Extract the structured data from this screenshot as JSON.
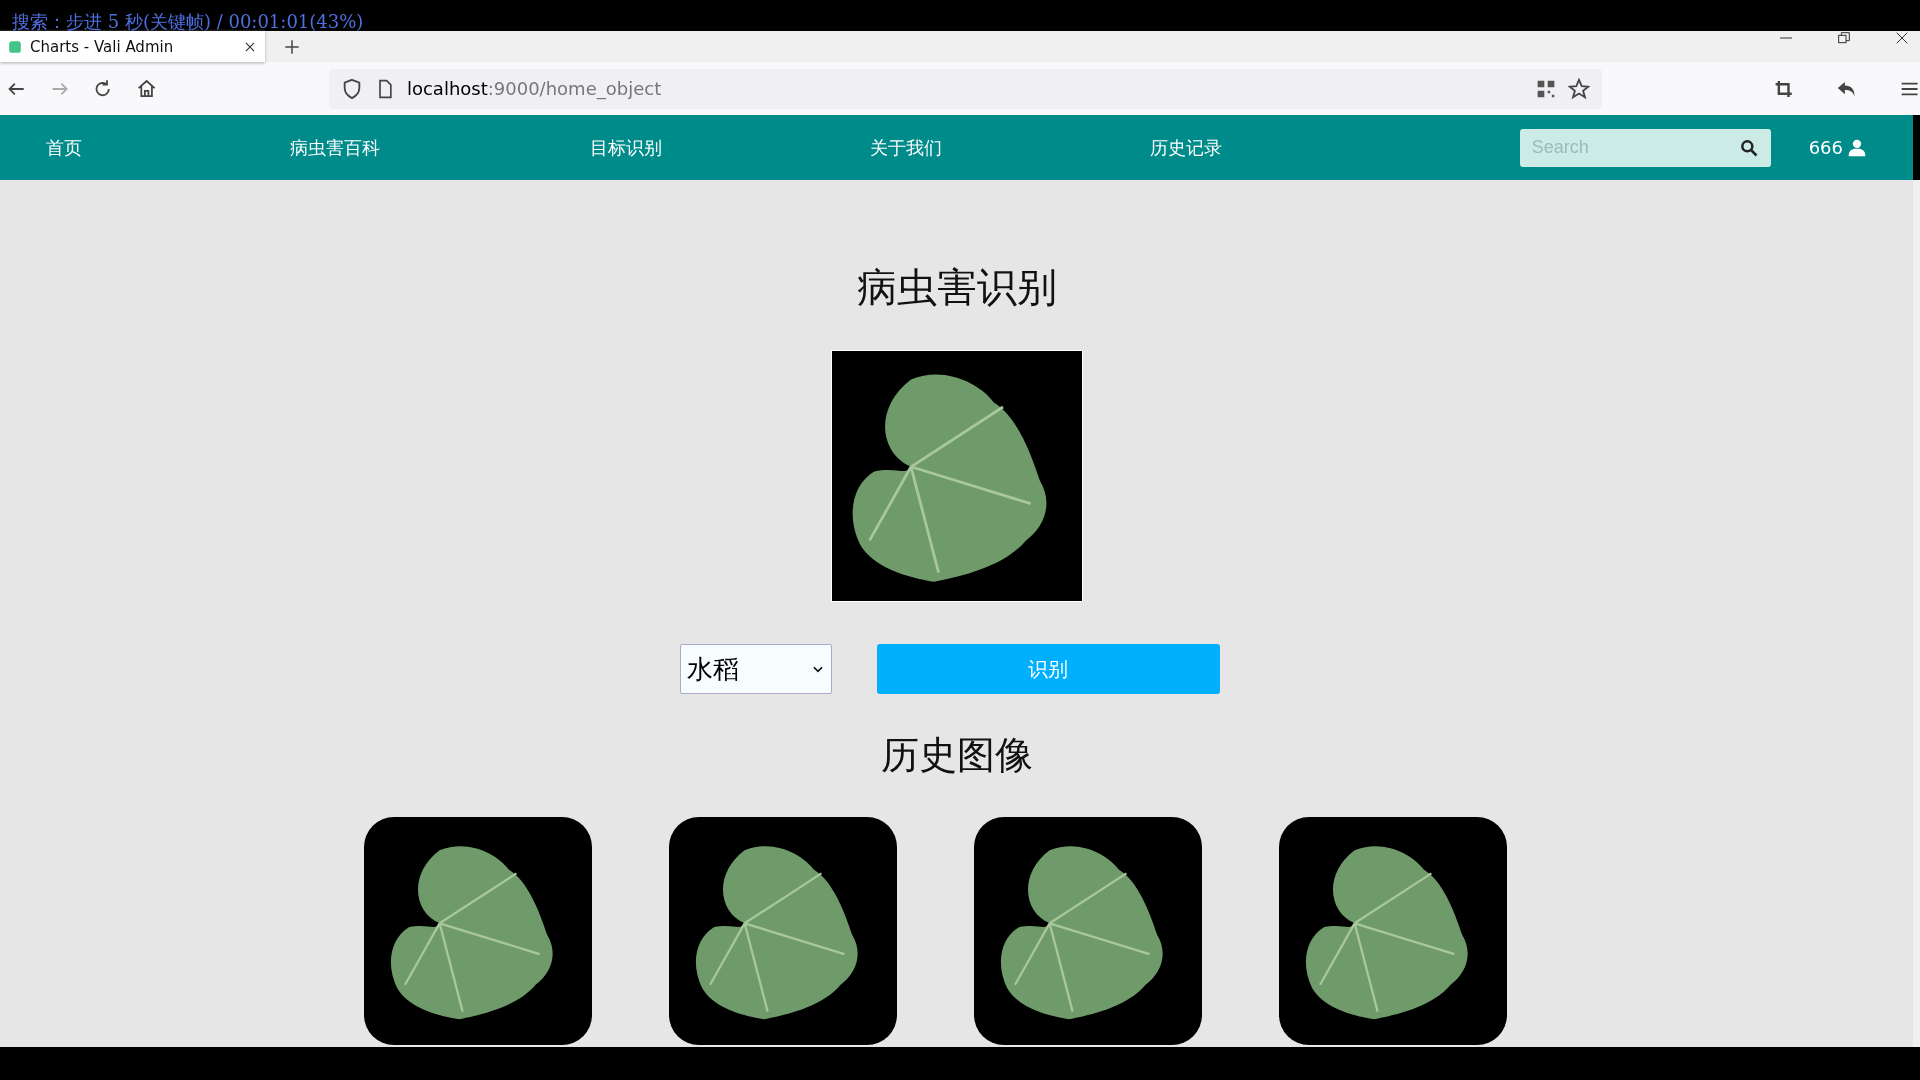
{
  "player_overlay": "搜索：步进 5 秒(关键帧) / 00:01:01(43%)",
  "browser": {
    "tab_title": "Charts - Vali Admin",
    "url_host": "localhost",
    "url_path": ":9000/home_object"
  },
  "nav": {
    "items": [
      {
        "label": "首页"
      },
      {
        "label": "病虫害百科"
      },
      {
        "label": "目标识别"
      },
      {
        "label": "关于我们"
      },
      {
        "label": "历史记录"
      }
    ],
    "search": {
      "placeholder": "Search"
    },
    "user": "666"
  },
  "main": {
    "title": "病虫害识别",
    "crop_select": {
      "value": "水稻"
    },
    "recognize_button": "识别",
    "history_title": "历史图像",
    "history_images": [
      {
        "kind": "photo"
      },
      {
        "kind": "photo"
      },
      {
        "kind": "photo"
      },
      {
        "kind": "photo"
      }
    ]
  }
}
